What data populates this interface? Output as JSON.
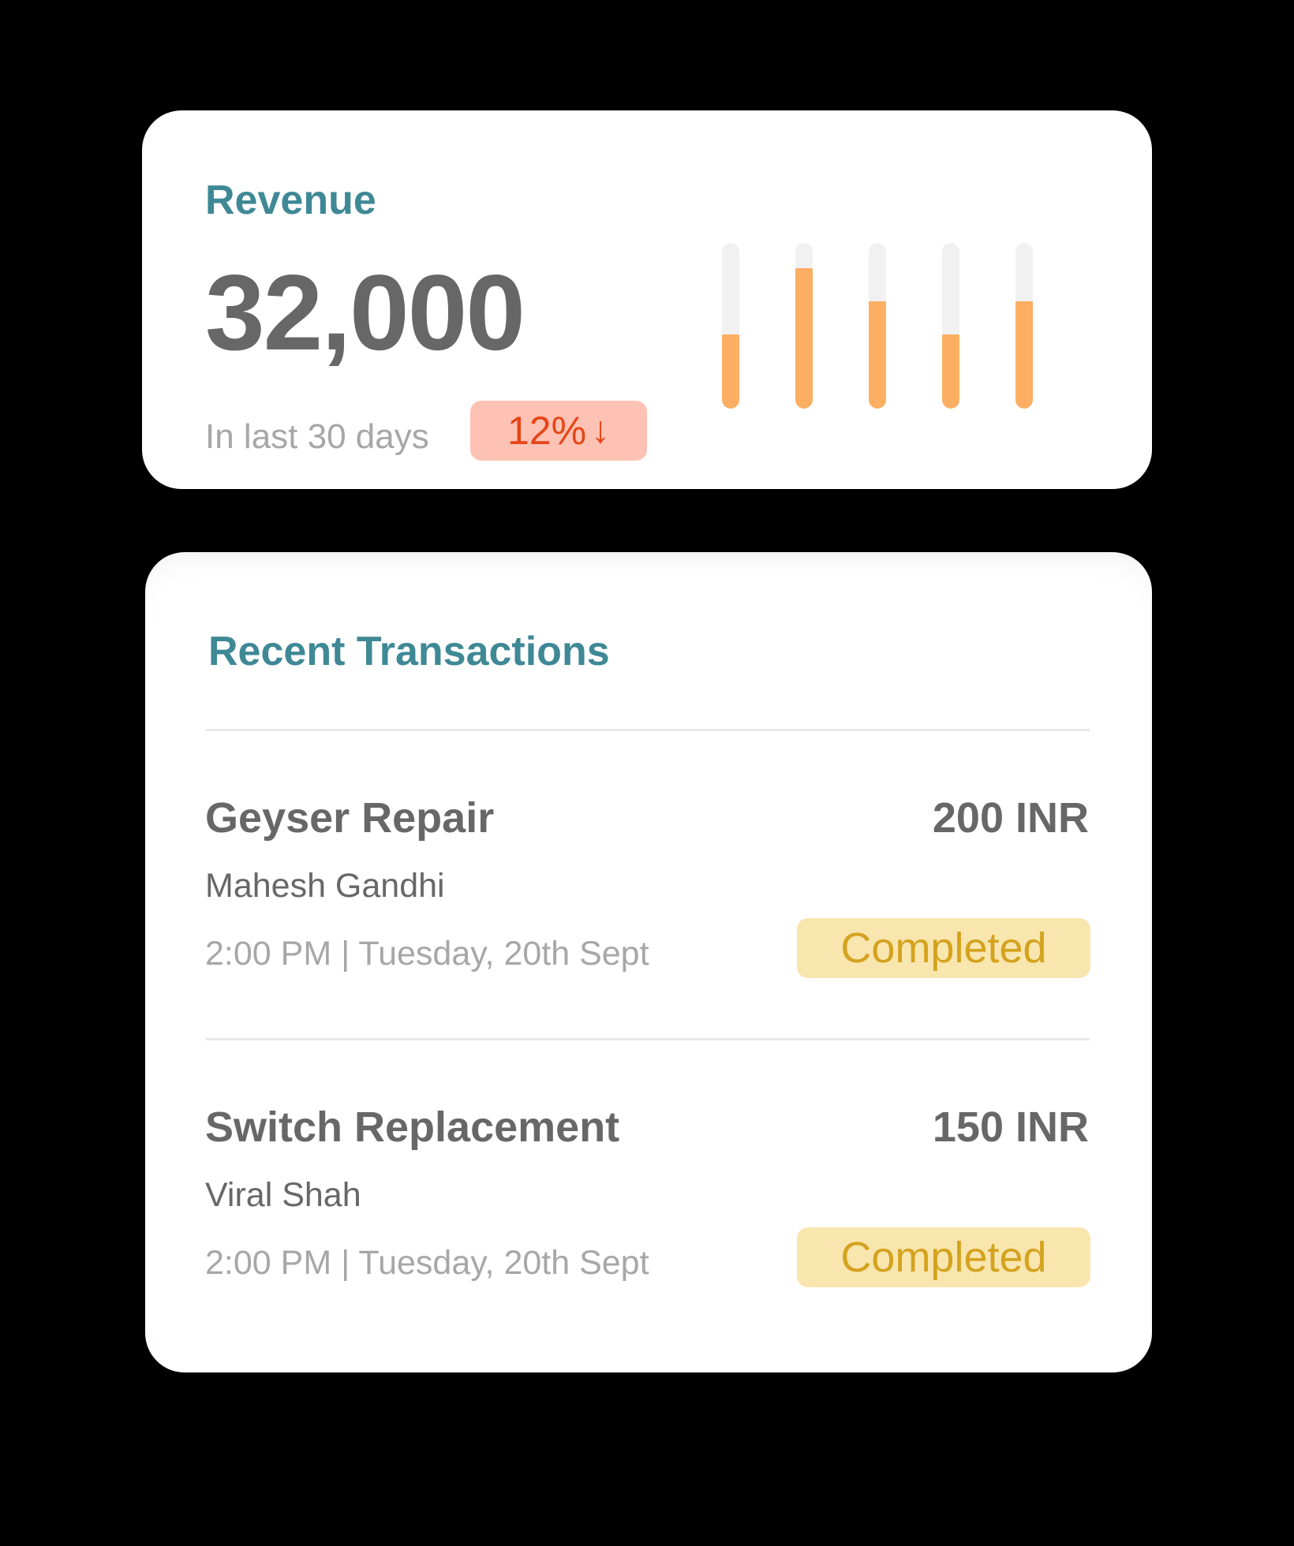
{
  "revenue": {
    "title": "Revenue",
    "value": "32,000",
    "period": "In last 30 days",
    "change": {
      "value": "12%",
      "direction": "down",
      "color": "#e64518",
      "background": "#fdc2b3"
    },
    "mini_chart": {
      "levels": [
        0.45,
        0.85,
        0.65,
        0.45,
        0.65
      ],
      "fill_color": "#fcae63",
      "track_color": "#f1f1f1"
    }
  },
  "transactions": {
    "title": "Recent Transactions",
    "items": [
      {
        "service": "Geyser Repair",
        "amount": "200 INR",
        "customer": "Mahesh Gandhi",
        "time": "2:00 PM | Tuesday, 20th Sept",
        "status": "Completed"
      },
      {
        "service": "Switch Replacement",
        "amount": "150 INR",
        "customer": "Viral Shah",
        "time": "2:00 PM | Tuesday, 20th Sept",
        "status": "Completed"
      }
    ]
  },
  "colors": {
    "background": "#000000",
    "card": "#ffffff",
    "accent": "#3f8896",
    "primary_text": "#676767",
    "secondary_text": "#a7a7a7",
    "status_background": "#f9e6ae",
    "status_text": "#d4a21e"
  }
}
